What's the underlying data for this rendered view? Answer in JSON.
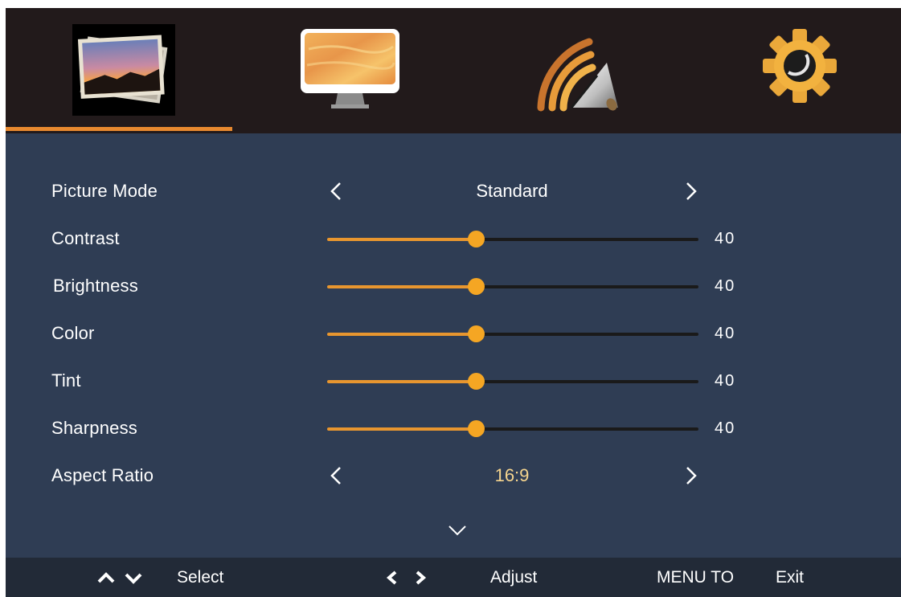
{
  "tabs": [
    {
      "icon": "picture-icon",
      "selected": true
    },
    {
      "icon": "monitor-icon",
      "selected": false
    },
    {
      "icon": "signal-icon",
      "selected": false
    },
    {
      "icon": "gear-icon",
      "selected": false
    }
  ],
  "menu": {
    "picture_mode": {
      "label": "Picture Mode",
      "value": "Standard"
    },
    "contrast": {
      "label": "Contrast",
      "value": 40,
      "display": "40"
    },
    "brightness": {
      "label": "Brightness",
      "value": 40,
      "display": "40"
    },
    "color": {
      "label": "Color",
      "value": 40,
      "display": "40"
    },
    "tint": {
      "label": "Tint",
      "value": 40,
      "display": "40"
    },
    "sharpness": {
      "label": "Sharpness",
      "value": 40,
      "display": "40"
    },
    "aspect_ratio": {
      "label": "Aspect Ratio",
      "value": "16:9"
    }
  },
  "slider_max": 100,
  "footer": {
    "select": "Select",
    "adjust": "Adjust",
    "menu_to": "MENU TO",
    "exit": "Exit"
  },
  "colors": {
    "accent": "#e8892f",
    "background": "#2f3d54",
    "topbar": "#221a1b",
    "footer": "#222a37",
    "thumb": "#f5a623",
    "value_highlight": "#f6d58e"
  }
}
